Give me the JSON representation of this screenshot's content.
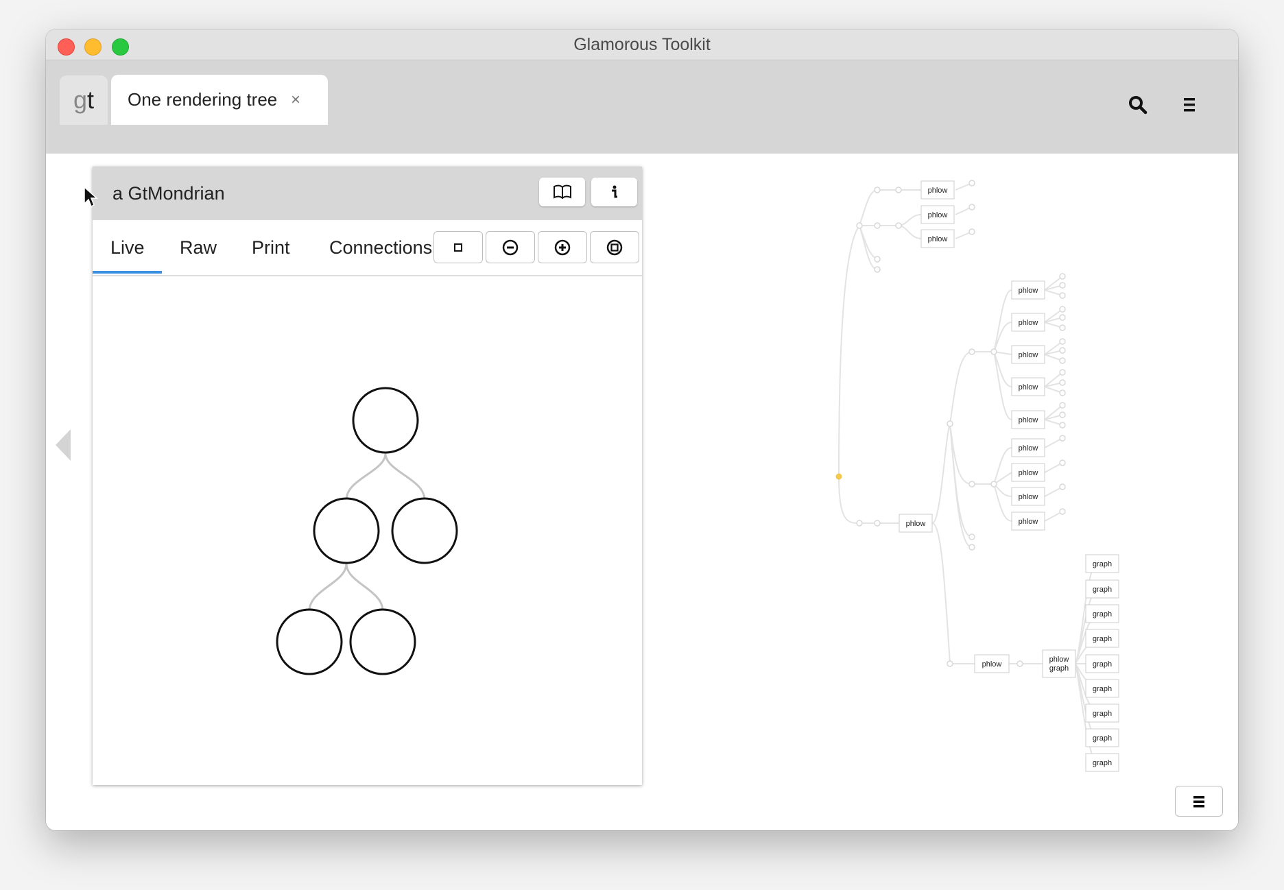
{
  "window": {
    "title": "Glamorous Toolkit",
    "controls": [
      "close",
      "minimize",
      "zoom"
    ]
  },
  "tabbar": {
    "logo": {
      "g": "g",
      "t": "t"
    },
    "active_tab": {
      "label": "One rendering tree",
      "close_glyph": "×"
    },
    "icons": [
      "search-icon",
      "menu-icon"
    ]
  },
  "pane": {
    "title": "a GtMondrian",
    "header_icons": [
      "book-icon",
      "info-icon"
    ],
    "view_tabs": [
      "Live",
      "Raw",
      "Print",
      "Connections"
    ],
    "active_view_tab": "Live",
    "toolbar_icons": [
      "square-icon",
      "zoom-out-icon",
      "zoom-in-icon",
      "zoom-to-fit-icon"
    ],
    "mondrian_nodes": 5
  },
  "tree": {
    "phlow_label": "phlow",
    "graph_label": "graph",
    "phlow_graph_label": [
      "phlow",
      "graph"
    ],
    "top_group_count": 3,
    "middle_group_count": 9,
    "graph_group_count": 9,
    "root_color": "#f2c94c"
  },
  "colors": {
    "tab_underline": "#3b8fe0",
    "tabbar_bg": "#d6d6d6",
    "header_bg": "#d7d7d7"
  }
}
